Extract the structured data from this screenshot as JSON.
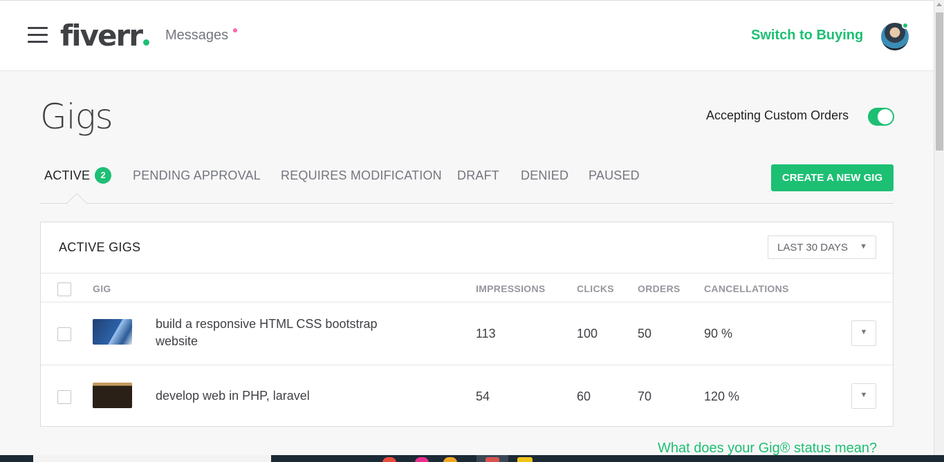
{
  "header": {
    "logo_text": "fiverr",
    "messages_label": "Messages",
    "switch_label": "Switch to Buying"
  },
  "page": {
    "title": "Gigs",
    "custom_orders_label": "Accepting Custom Orders",
    "custom_orders_enabled": true
  },
  "tabs": [
    {
      "label": "ACTIVE",
      "count": "2"
    },
    {
      "label": "PENDING APPROVAL"
    },
    {
      "label": "REQUIRES MODIFICATION"
    },
    {
      "label": "DRAFT"
    },
    {
      "label": "DENIED"
    },
    {
      "label": "PAUSED"
    }
  ],
  "create_button_label": "CREATE A NEW GIG",
  "card": {
    "title": "ACTIVE GIGS",
    "period": "LAST 30 DAYS",
    "columns": {
      "gig": "GIG",
      "impressions": "IMPRESSIONS",
      "clicks": "CLICKS",
      "orders": "ORDERS",
      "cancellations": "CANCELLATIONS"
    },
    "rows": [
      {
        "title": "build a responsive HTML CSS bootstrap website",
        "impressions": "113",
        "clicks": "100",
        "orders": "50",
        "cancellations": "90 %"
      },
      {
        "title": "develop web in PHP, laravel",
        "impressions": "54",
        "clicks": "60",
        "orders": "70",
        "cancellations": "120 %"
      }
    ]
  },
  "help_link": "What does your Gig® status mean?",
  "colors": {
    "brand_green": "#1dbf73",
    "notification_pink": "#ff62ad"
  },
  "icons": {
    "menu": "hamburger-menu-icon",
    "dropdown": "triangle-down-icon"
  }
}
